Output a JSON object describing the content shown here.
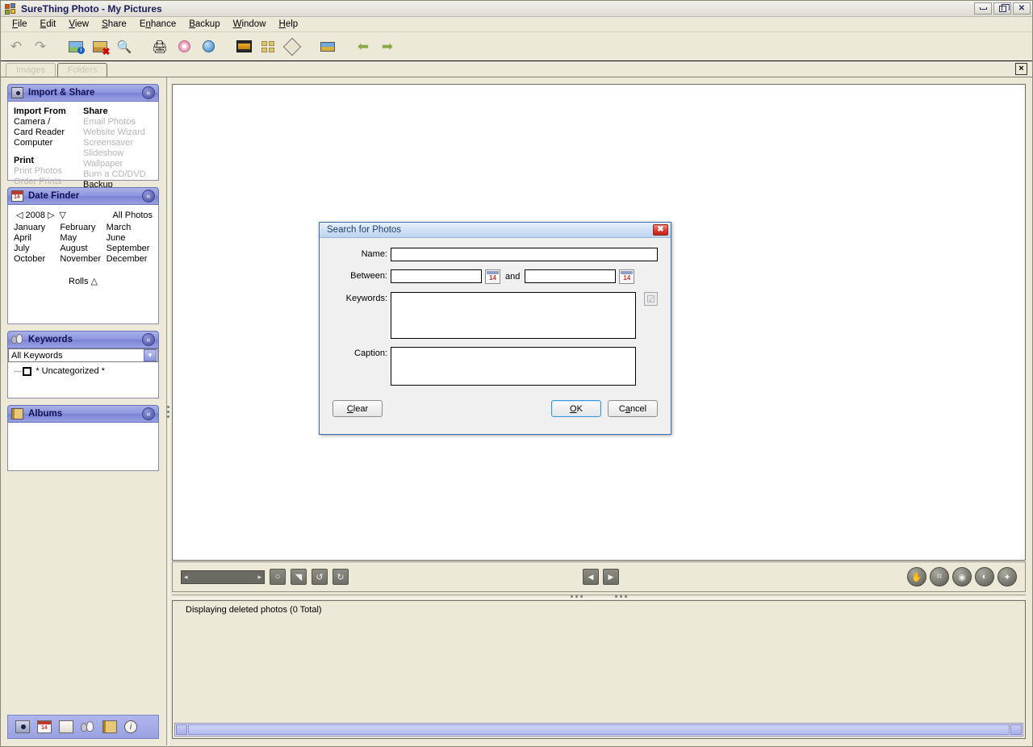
{
  "window": {
    "title": "SureThing Photo - My Pictures",
    "app_icon": "windows-logo-icon",
    "buttons": {
      "minimize": "minimize-icon",
      "restore": "restore-icon",
      "close": "close-icon"
    }
  },
  "menubar": {
    "items": [
      {
        "label": "File",
        "accel": "F"
      },
      {
        "label": "Edit",
        "accel": "E"
      },
      {
        "label": "View",
        "accel": "V"
      },
      {
        "label": "Share",
        "accel": "S"
      },
      {
        "label": "Enhance",
        "accel": "n"
      },
      {
        "label": "Backup",
        "accel": "B"
      },
      {
        "label": "Window",
        "accel": "W"
      },
      {
        "label": "Help",
        "accel": "H"
      }
    ]
  },
  "toolbar": {
    "buttons": [
      {
        "name": "undo-icon",
        "glyph": "↶",
        "enabled": false
      },
      {
        "name": "redo-icon",
        "glyph": "↷",
        "enabled": false
      },
      {
        "name": "photo-info-icon",
        "glyph": "",
        "enabled": true
      },
      {
        "name": "delete-photo-icon",
        "glyph": "",
        "enabled": true
      },
      {
        "name": "search-photos-icon",
        "glyph": "🔍",
        "enabled": true
      },
      {
        "name": "print-icon",
        "glyph": "⎙",
        "enabled": true
      },
      {
        "name": "burn-cd-icon",
        "glyph": "",
        "enabled": true
      },
      {
        "name": "web-wizard-icon",
        "glyph": "",
        "enabled": true
      },
      {
        "name": "slideshow-icon",
        "glyph": "",
        "enabled": true
      },
      {
        "name": "thumbnail-grid-icon",
        "glyph": "",
        "enabled": true
      },
      {
        "name": "fullscreen-icon",
        "glyph": "",
        "enabled": true
      },
      {
        "name": "card-view-icon",
        "glyph": "",
        "enabled": true
      },
      {
        "name": "back-arrow-icon",
        "glyph": "⇦",
        "enabled": true
      },
      {
        "name": "forward-arrow-icon",
        "glyph": "⇨",
        "enabled": true
      }
    ]
  },
  "tabs": {
    "items": [
      {
        "label": "Images",
        "active": false
      },
      {
        "label": "Folders",
        "active": true
      }
    ],
    "close_label": "×"
  },
  "sidebar": {
    "import_share": {
      "title": "Import & Share",
      "collapse_glyph": "«",
      "import_from_header": "Import From",
      "import_from_items": [
        {
          "label": "Camera /",
          "enabled": true
        },
        {
          "label": "Card Reader",
          "enabled": true
        },
        {
          "label": "Computer",
          "enabled": true
        }
      ],
      "print_header": "Print",
      "print_items": [
        {
          "label": "Print Photos",
          "enabled": false
        },
        {
          "label": "Order Prints",
          "enabled": false
        }
      ],
      "share_header": "Share",
      "share_items": [
        {
          "label": "Email Photos",
          "enabled": false
        },
        {
          "label": "Website Wizard",
          "enabled": false
        },
        {
          "label": "Screensaver",
          "enabled": false
        },
        {
          "label": "Slideshow",
          "enabled": false
        },
        {
          "label": "Wallpaper",
          "enabled": false
        },
        {
          "label": "Burn a CD/DVD",
          "enabled": false
        },
        {
          "label": "Backup",
          "enabled": true
        }
      ]
    },
    "date_finder": {
      "title": "Date Finder",
      "collapse_glyph": "«",
      "prev_glyph": "◁",
      "next_glyph": "▷",
      "dropdown_glyph": "▽",
      "year": "2008",
      "all_photos": "All Photos",
      "months": [
        "January",
        "February",
        "March",
        "April",
        "May",
        "June",
        "July",
        "August",
        "September",
        "October",
        "November",
        "December"
      ],
      "rolls_label": "Rolls",
      "rolls_glyph": "△"
    },
    "keywords": {
      "title": "Keywords",
      "collapse_glyph": "«",
      "selected": "All Keywords",
      "dropdown_glyph": "▼",
      "tree_prefix": "····",
      "item": "* Uncategorized *"
    },
    "albums": {
      "title": "Albums",
      "collapse_glyph": "«"
    },
    "bottom_bar": [
      {
        "name": "camera-icon"
      },
      {
        "name": "calendar-icon"
      },
      {
        "name": "folder-icon"
      },
      {
        "name": "people-keywords-icon"
      },
      {
        "name": "album-icon"
      },
      {
        "name": "info-icon",
        "glyph": "i"
      }
    ]
  },
  "bottom_toolbar": {
    "zoom_left_glyph": "◂",
    "zoom_right_glyph": "▸",
    "buttons": [
      {
        "name": "rotate-fix-icon",
        "glyph": "○"
      },
      {
        "name": "crop-icon",
        "glyph": "◥"
      },
      {
        "name": "rotate-left-icon",
        "glyph": "↺"
      },
      {
        "name": "rotate-right-icon",
        "glyph": "↻"
      }
    ],
    "nav": [
      {
        "name": "previous-photo-button",
        "glyph": "◀"
      },
      {
        "name": "next-photo-button",
        "glyph": "▶"
      }
    ],
    "round_buttons": [
      {
        "name": "pan-hand-icon",
        "glyph": "✋"
      },
      {
        "name": "crop-tool-icon",
        "glyph": "⌗"
      },
      {
        "name": "red-eye-icon",
        "glyph": "◉"
      },
      {
        "name": "color-adjust-icon",
        "glyph": "◐"
      },
      {
        "name": "magic-fix-icon",
        "glyph": "✦"
      }
    ]
  },
  "status": {
    "text": "Displaying deleted photos (0 Total)"
  },
  "dialog": {
    "title": "Search for Photos",
    "close_glyph": "✖",
    "fields": {
      "name_label": "Name:",
      "name_value": "",
      "between_label": "Between:",
      "between_from_value": "",
      "between_to_value": "",
      "and_label": "and",
      "keywords_label": "Keywords:",
      "keywords_value": "",
      "caption_label": "Caption:",
      "caption_value": ""
    },
    "keywords_picker_icon": "checkbox-check-icon",
    "calendar_icon": "calendar-picker-icon",
    "buttons": {
      "clear": {
        "label": "Clear",
        "accel": "C"
      },
      "ok": {
        "label": "OK",
        "accel": "O",
        "default": true
      },
      "cancel": {
        "label": "Cancel",
        "accel": "a"
      }
    }
  },
  "colors": {
    "panel_header_blue": "#8d95de",
    "title_text": "#1a1a5e",
    "window_bg": "#ece9d8",
    "dialog_border": "#3c6fa8",
    "close_red": "#d9392a",
    "scrollbar_blue": "#b4bcee"
  }
}
